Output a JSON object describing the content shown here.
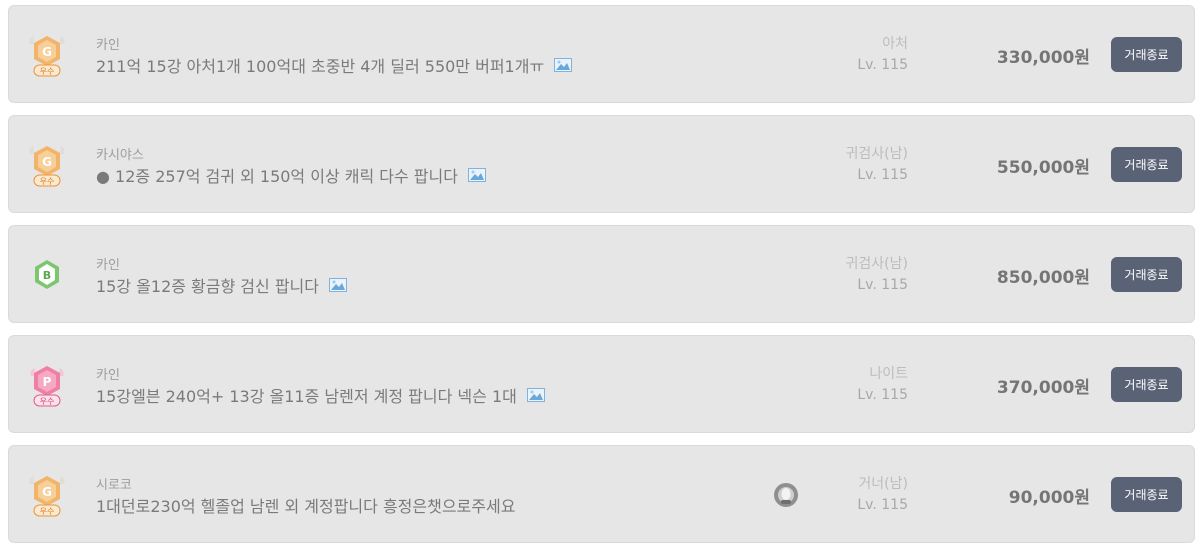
{
  "listings": [
    {
      "badge": "gold-g-grade-badge",
      "badge_letter": "G",
      "badge_grade": "우수",
      "seller": "카인",
      "title": "211억 15강 아처1개 100억대 초중반 4개 딜러 550만 버퍼1개ㅠ",
      "has_image": true,
      "has_avatar": false,
      "class_name": "아처",
      "level": "Lv. 115",
      "price": "330,000원",
      "status": "거래종료"
    },
    {
      "badge": "gold-g-grade-badge",
      "badge_letter": "G",
      "badge_grade": "우수",
      "seller": "카시야스",
      "title": "● 12증 257억 검귀 외 150억 이상 캐릭 다수 팝니다",
      "has_image": true,
      "has_avatar": false,
      "class_name": "귀검사(남)",
      "level": "Lv. 115",
      "price": "550,000원",
      "status": "거래종료"
    },
    {
      "badge": "green-b-grade-badge",
      "badge_letter": "B",
      "badge_grade": "",
      "seller": "카인",
      "title": "15강 올12증 황금향 검신 팝니다",
      "has_image": true,
      "has_avatar": false,
      "class_name": "귀검사(남)",
      "level": "Lv. 115",
      "price": "850,000원",
      "status": "거래종료"
    },
    {
      "badge": "pink-p-grade-badge",
      "badge_letter": "P",
      "badge_grade": "우수",
      "seller": "카인",
      "title": "15강엘븐 240억+ 13강 올11증 남렌저 계정 팝니다 넥슨 1대",
      "has_image": true,
      "has_avatar": false,
      "class_name": "나이트",
      "level": "Lv. 115",
      "price": "370,000원",
      "status": "거래종료"
    },
    {
      "badge": "gold-g-grade-badge",
      "badge_letter": "G",
      "badge_grade": "우수",
      "seller": "시로코",
      "title": "1대던로230억 헬졸업 남렌 외 계정팝니다 흥정은챗으로주세요",
      "has_image": false,
      "has_avatar": true,
      "class_name": "거너(남)",
      "level": "Lv. 115",
      "price": "90,000원",
      "status": "거래종료"
    }
  ],
  "colors": {
    "row_background": "#e6e6e6",
    "button_background": "#5a6276",
    "gold_badge": "#f2b36a",
    "green_badge": "#7cc76e",
    "pink_badge": "#f07fa5"
  }
}
